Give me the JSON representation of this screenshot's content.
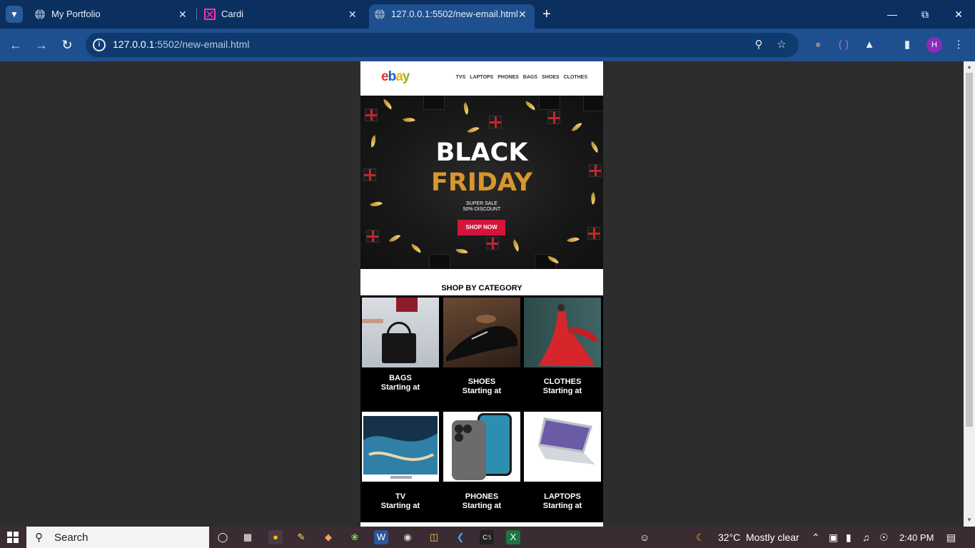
{
  "browser": {
    "tabs": [
      {
        "title": "My Portfolio",
        "icon": "globe-icon"
      },
      {
        "title": "Cardi",
        "icon": "figma-like-icon"
      },
      {
        "title": "127.0.0.1:5502/new-email.html",
        "icon": "globe-icon",
        "active": true
      }
    ],
    "url_host": "127.0.0.1",
    "url_rest": ":5502/new-email.html",
    "profile_initial": "H"
  },
  "email": {
    "logo": {
      "e": "e",
      "b": "b",
      "a": "a",
      "y": "y"
    },
    "nav": [
      "TVS",
      "LAPTOPS",
      "PHONES",
      "BAGS",
      "SHOES",
      "CLOTHES"
    ],
    "hero": {
      "line1": "BLACK",
      "line2": "FRIDAY",
      "sub1": "SUPER SALE",
      "sub2": "50% DISCOUNT",
      "cta": "SHOP NOW"
    },
    "category_title": "SHOP BY CATEGORY",
    "categories": [
      {
        "name": "BAGS",
        "sub": "Starting at"
      },
      {
        "name": "SHOES",
        "sub": "Starting at"
      },
      {
        "name": "CLOTHES",
        "sub": "Starting at"
      },
      {
        "name": "TV",
        "sub": "Starting at"
      },
      {
        "name": "PHONES",
        "sub": "Starting at"
      },
      {
        "name": "LAPTOPS",
        "sub": "Starting at"
      }
    ]
  },
  "taskbar": {
    "search_placeholder": "Search",
    "weather_temp": "32°C",
    "weather_text": "Mostly clear",
    "time": "2:40 PM"
  },
  "colors": {
    "brand_red": "#d3143c",
    "friday_gold": "#d9962b",
    "chrome_blue": "#1e4f8e"
  }
}
